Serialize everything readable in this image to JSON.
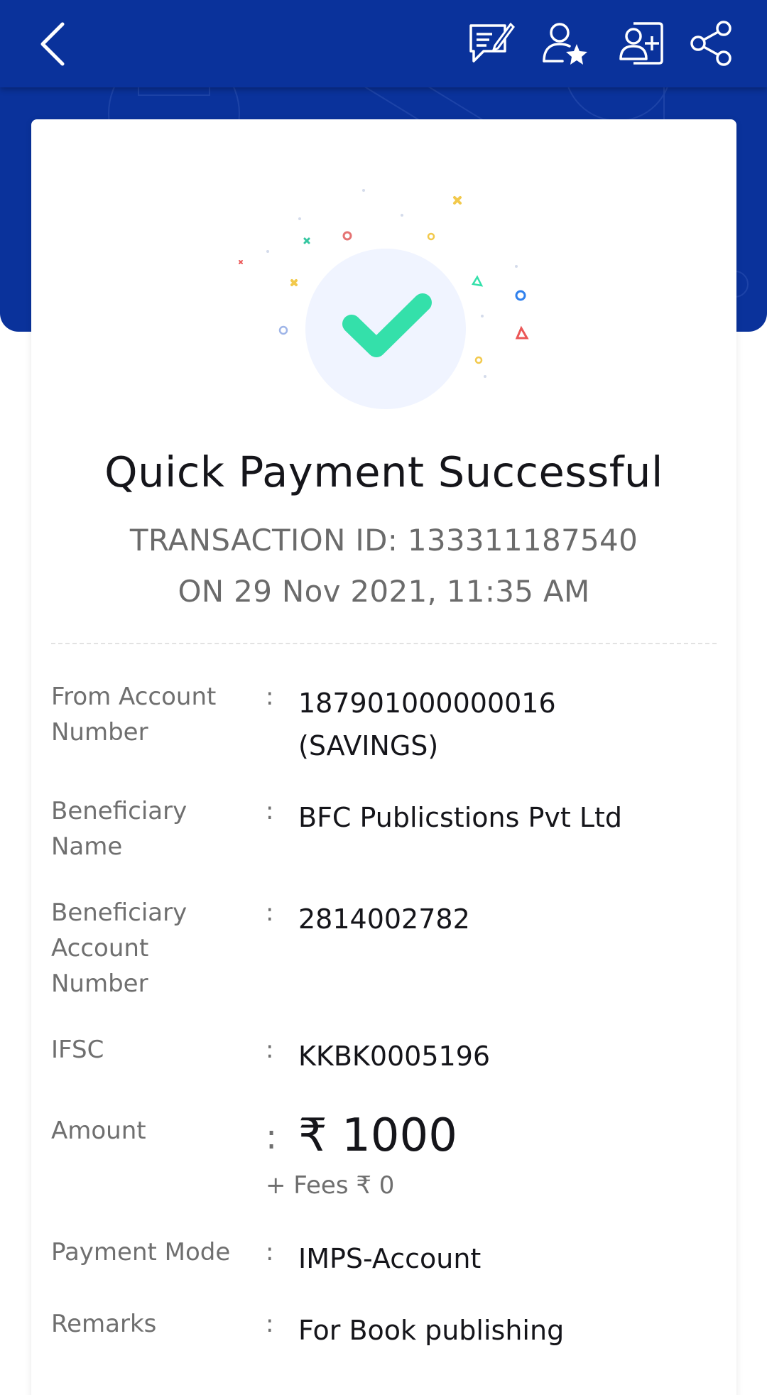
{
  "header": {
    "back_icon": "back-arrow-icon",
    "actions": [
      "message-icon",
      "favourite-payee-icon",
      "add-payee-icon",
      "share-icon"
    ]
  },
  "colors": {
    "brand": "#0a329b",
    "success": "#34e0aa",
    "text_primary": "#15151a",
    "text_secondary": "#6f6f6f"
  },
  "receipt": {
    "title": "Quick Payment Successful",
    "transaction_id": "TRANSACTION ID: 133311187540",
    "date": "ON 29 Nov 2021, 11:35 AM",
    "status_icon": "check-icon",
    "details": {
      "from_account": {
        "label_line1": "From Account",
        "label_line2": "Number",
        "value_line1": "187901000000016",
        "value_line2": "(SAVINGS)"
      },
      "beneficiary_name": {
        "label_line1": "Beneficiary",
        "label_line2": "Name",
        "value": "BFC Publicstions Pvt Ltd"
      },
      "beneficiary_account": {
        "label_line1": "Beneficiary",
        "label_line2": "Account",
        "label_line3": "Number",
        "value": "2814002782"
      },
      "ifsc": {
        "label": "IFSC",
        "value": "KKBK0005196"
      },
      "amount": {
        "label": "Amount",
        "value": "₹ 1000",
        "fees": "+ Fees ₹ 0"
      },
      "payment_mode": {
        "label": "Payment Mode",
        "value": "IMPS-Account"
      },
      "remarks": {
        "label": "Remarks",
        "value": "For Book publishing"
      }
    },
    "separator": ":"
  }
}
